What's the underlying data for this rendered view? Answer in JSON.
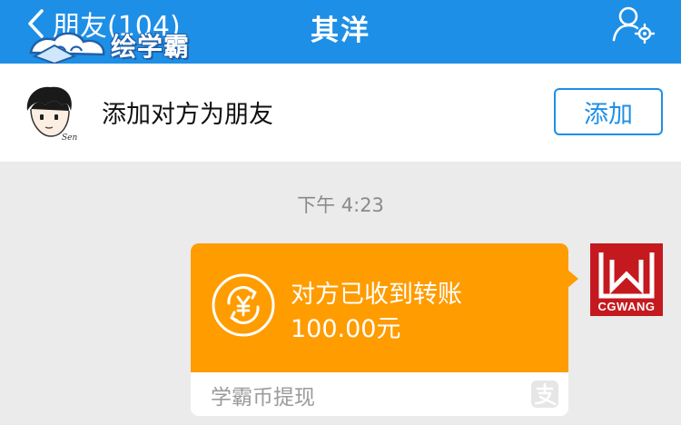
{
  "header": {
    "back_label": "朋友(104)",
    "title": "其洋",
    "watermark": "绘学霸"
  },
  "add_friend": {
    "text": "添加对方为朋友",
    "button_label": "添加"
  },
  "chat": {
    "timestamp": "下午 4:23",
    "transfer": {
      "status": "对方已收到转账",
      "amount": "100.00元",
      "footer": "学霸币提现",
      "icon": "yen-exchange-icon"
    },
    "sender_avatar_text": "CGWANG"
  },
  "colors": {
    "header": "#1e8fe6",
    "transfer_orange": "#ff9c00",
    "background": "#ebebeb",
    "avatar_red": "#c41a1f"
  }
}
